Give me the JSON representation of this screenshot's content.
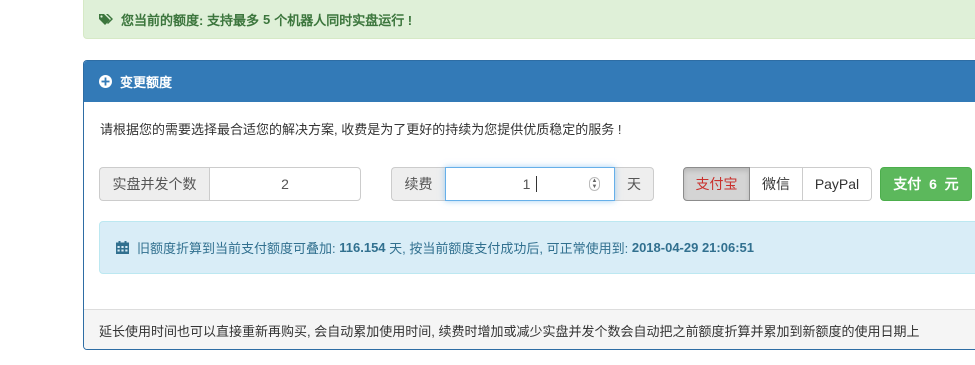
{
  "quota_alert": {
    "prefix": "您当前的额度: 支持最多",
    "count": "5",
    "suffix": "个机器人同时实盘运行 !"
  },
  "panel": {
    "title": "变更额度",
    "description": "请根据您的需要选择最合适您的解决方案, 收费是为了更好的持续为您提供优质稳定的服务 !",
    "count_label": "实盘并发个数",
    "count_value": "2",
    "fee_label": "续费",
    "fee_value": "1",
    "fee_unit": "天",
    "payment_methods": [
      "支付宝",
      "微信",
      "PayPal"
    ],
    "selected_payment": "支付宝",
    "pay_button": "支付  6  元",
    "info": {
      "text1": "旧额度折算到当前支付额度可叠加:",
      "days": "116.154",
      "text2": "天, 按当前额度支付成功后, 可正常使用到:",
      "date": "2018-04-29 21:06:51"
    },
    "footer": "延长使用时间也可以直接重新再购买, 会自动累加使用时间, 续费时增加或减少实盘并发个数会自动把之前额度折算并累加到新额度的使用日期上"
  },
  "colors": {
    "primary": "#337ab7",
    "success": "#5cb85c",
    "alert_green_bg": "#dff0d8",
    "info_bg": "#d9edf7"
  },
  "icons": [
    "tags-icon",
    "plus-circle-icon",
    "calendar-icon",
    "spinner-icon"
  ]
}
